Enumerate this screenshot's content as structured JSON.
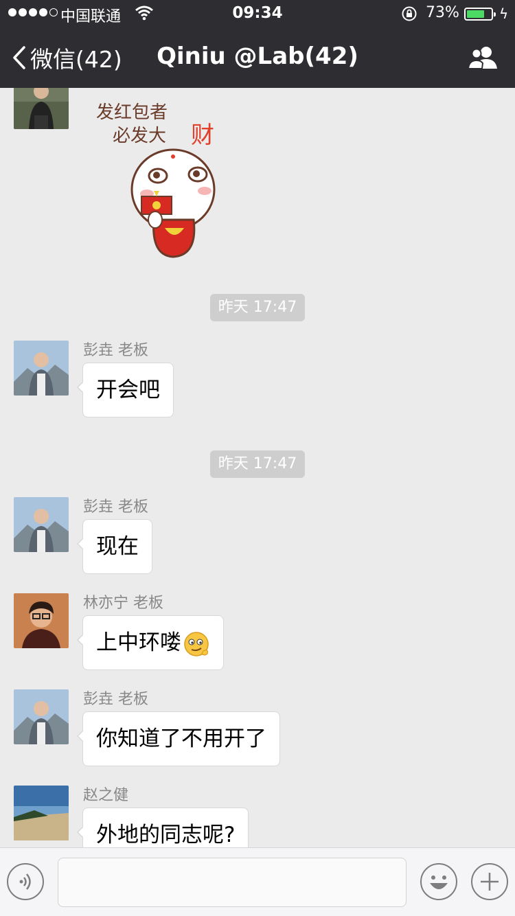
{
  "status_bar": {
    "carrier": "中国联通",
    "time": "09:34",
    "battery_percent": "73%",
    "battery_level": 0.73,
    "signal_bars_filled": 4,
    "signal_bars_total": 5
  },
  "nav": {
    "back_label": "微信(42)",
    "title": "Qiniu @Lab(42)",
    "group_icon": "group-members-icon"
  },
  "sticker": {
    "text_line1": "发红包者",
    "text_line2": "必发大",
    "text_accent": "财"
  },
  "messages": [
    {
      "type": "time",
      "text": "昨天 17:47"
    },
    {
      "type": "msg",
      "sender": "彭垚 老板",
      "text": "开会吧"
    },
    {
      "type": "time",
      "text": "昨天 17:47"
    },
    {
      "type": "msg",
      "sender": "彭垚 老板",
      "text": "现在"
    },
    {
      "type": "msg",
      "sender": "林亦宁 老板",
      "text": "上中环喽",
      "emoji": "smirk-emoji-icon"
    },
    {
      "type": "msg",
      "sender": "彭垚 老板",
      "text": "你知道了不用开了"
    },
    {
      "type": "msg",
      "sender": "赵之健",
      "text": "外地的同志呢?"
    }
  ],
  "input_bar": {
    "voice_icon": "voice-icon",
    "emoji_icon": "emoji-icon",
    "more_icon": "plus-icon"
  },
  "colors": {
    "nav_bg": "#2e2e32",
    "chat_bg": "#ebebeb",
    "battery_fill": "#4cd964",
    "time_bg": "#cecece"
  }
}
